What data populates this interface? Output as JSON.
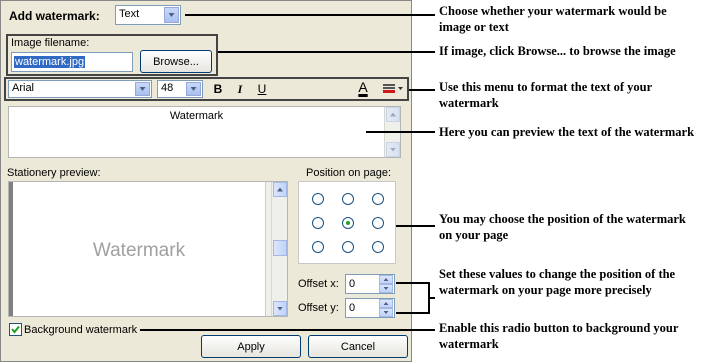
{
  "dialog": {
    "add_watermark_label": "Add watermark:",
    "watermark_type": "Text",
    "image_filename_label": "Image filename:",
    "image_filename_value": "watermark.jpg",
    "browse_label": "Browse...",
    "font_name": "Arial",
    "font_size": "48",
    "bold_label": "B",
    "italic_label": "I",
    "underline_label": "U",
    "font_color_label": "A",
    "preview_text": "Watermark",
    "stationery_preview_label": "Stationery preview:",
    "stationery_watermark": "Watermark",
    "position_label": "Position on page:",
    "offset_x_label": "Offset x:",
    "offset_x_value": "0",
    "offset_y_label": "Offset y:",
    "offset_y_value": "0",
    "background_watermark_label": "Background watermark",
    "background_watermark_checked": true,
    "apply_label": "Apply",
    "cancel_label": "Cancel",
    "selected_position": "center"
  },
  "annotations": [
    "Choose whether your watermark would be image or text",
    "If image, click Browse... to browse the image",
    "Use this menu to format the text of your watermark",
    "Here you can preview the text of the watermark",
    "You may choose the position of the watermark on your page",
    "Set these values to change the position of the watermark on your page more precisely",
    "Enable this radio button to background your watermark"
  ],
  "colors": {
    "dialog_bg": "#ece9d8",
    "selection": "#316ac5",
    "radio_dot": "#21a121",
    "font_color_bar": "#000000",
    "highlight_color_bar": "#d01818"
  }
}
